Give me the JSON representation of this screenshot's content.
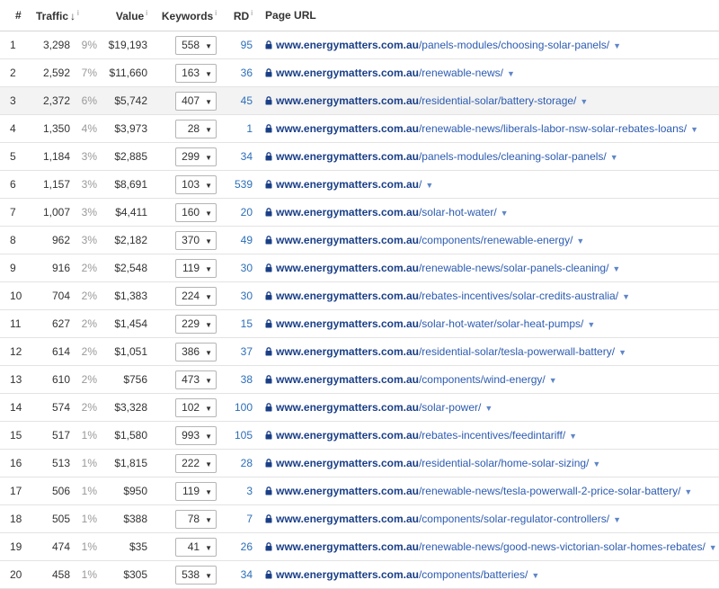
{
  "table": {
    "headers": {
      "idx": "#",
      "traffic": "Traffic",
      "value": "Value",
      "keywords": "Keywords",
      "rd": "RD",
      "url": "Page URL",
      "info": "i"
    },
    "domain": "www.energymatters.com.au",
    "rows": [
      {
        "idx": "1",
        "traffic": "3,298",
        "pct": "9%",
        "value": "$19,193",
        "keywords": "558",
        "rd": "95",
        "path": "/panels-modules/choosing-solar-panels/"
      },
      {
        "idx": "2",
        "traffic": "2,592",
        "pct": "7%",
        "value": "$11,660",
        "keywords": "163",
        "rd": "36",
        "path": "/renewable-news/"
      },
      {
        "idx": "3",
        "traffic": "2,372",
        "pct": "6%",
        "value": "$5,742",
        "keywords": "407",
        "rd": "45",
        "path": "/residential-solar/battery-storage/"
      },
      {
        "idx": "4",
        "traffic": "1,350",
        "pct": "4%",
        "value": "$3,973",
        "keywords": "28",
        "rd": "1",
        "path": "/renewable-news/liberals-labor-nsw-solar-rebates-loans/"
      },
      {
        "idx": "5",
        "traffic": "1,184",
        "pct": "3%",
        "value": "$2,885",
        "keywords": "299",
        "rd": "34",
        "path": "/panels-modules/cleaning-solar-panels/"
      },
      {
        "idx": "6",
        "traffic": "1,157",
        "pct": "3%",
        "value": "$8,691",
        "keywords": "103",
        "rd": "539",
        "path": "/"
      },
      {
        "idx": "7",
        "traffic": "1,007",
        "pct": "3%",
        "value": "$4,411",
        "keywords": "160",
        "rd": "20",
        "path": "/solar-hot-water/"
      },
      {
        "idx": "8",
        "traffic": "962",
        "pct": "3%",
        "value": "$2,182",
        "keywords": "370",
        "rd": "49",
        "path": "/components/renewable-energy/"
      },
      {
        "idx": "9",
        "traffic": "916",
        "pct": "2%",
        "value": "$2,548",
        "keywords": "119",
        "rd": "30",
        "path": "/renewable-news/solar-panels-cleaning/"
      },
      {
        "idx": "10",
        "traffic": "704",
        "pct": "2%",
        "value": "$1,383",
        "keywords": "224",
        "rd": "30",
        "path": "/rebates-incentives/solar-credits-australia/"
      },
      {
        "idx": "11",
        "traffic": "627",
        "pct": "2%",
        "value": "$1,454",
        "keywords": "229",
        "rd": "15",
        "path": "/solar-hot-water/solar-heat-pumps/"
      },
      {
        "idx": "12",
        "traffic": "614",
        "pct": "2%",
        "value": "$1,051",
        "keywords": "386",
        "rd": "37",
        "path": "/residential-solar/tesla-powerwall-battery/"
      },
      {
        "idx": "13",
        "traffic": "610",
        "pct": "2%",
        "value": "$756",
        "keywords": "473",
        "rd": "38",
        "path": "/components/wind-energy/"
      },
      {
        "idx": "14",
        "traffic": "574",
        "pct": "2%",
        "value": "$3,328",
        "keywords": "102",
        "rd": "100",
        "path": "/solar-power/"
      },
      {
        "idx": "15",
        "traffic": "517",
        "pct": "1%",
        "value": "$1,580",
        "keywords": "993",
        "rd": "105",
        "path": "/rebates-incentives/feedintariff/"
      },
      {
        "idx": "16",
        "traffic": "513",
        "pct": "1%",
        "value": "$1,815",
        "keywords": "222",
        "rd": "28",
        "path": "/residential-solar/home-solar-sizing/"
      },
      {
        "idx": "17",
        "traffic": "506",
        "pct": "1%",
        "value": "$950",
        "keywords": "119",
        "rd": "3",
        "path": "/renewable-news/tesla-powerwall-2-price-solar-battery/"
      },
      {
        "idx": "18",
        "traffic": "505",
        "pct": "1%",
        "value": "$388",
        "keywords": "78",
        "rd": "7",
        "path": "/components/solar-regulator-controllers/"
      },
      {
        "idx": "19",
        "traffic": "474",
        "pct": "1%",
        "value": "$35",
        "keywords": "41",
        "rd": "26",
        "path": "/renewable-news/good-news-victorian-solar-homes-rebates/"
      },
      {
        "idx": "20",
        "traffic": "458",
        "pct": "1%",
        "value": "$305",
        "keywords": "538",
        "rd": "34",
        "path": "/components/batteries/"
      }
    ]
  },
  "colors": {
    "domain": "#1a3f87",
    "path": "#2c5bb0",
    "rd": "#2c6eb8",
    "highlight_row": "#f3f3f3"
  },
  "icons": {
    "sort": "arrow-down-icon",
    "lock": "lock-icon",
    "caret": "caret-down-icon"
  }
}
